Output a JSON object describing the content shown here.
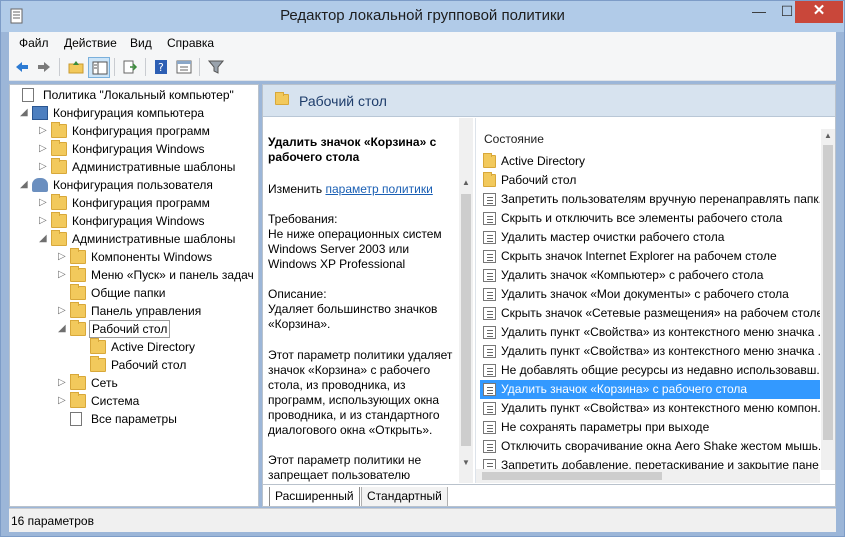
{
  "window": {
    "title": "Редактор локальной групповой политики"
  },
  "menu": {
    "items": [
      "Файл",
      "Действие",
      "Вид",
      "Справка"
    ]
  },
  "tree": {
    "items": [
      {
        "label": "Политика \"Локальный компьютер\"",
        "level": 0,
        "arrow": "",
        "icon": "policy-icon"
      },
      {
        "label": "Конфигурация компьютера",
        "level": 1,
        "arrow": "◢",
        "icon": "computer-icon"
      },
      {
        "label": "Конфигурация программ",
        "level": 2,
        "arrow": "▷",
        "icon": "folder-icon"
      },
      {
        "label": "Конфигурация Windows",
        "level": 2,
        "arrow": "▷",
        "icon": "folder-icon"
      },
      {
        "label": "Административные шаблоны",
        "level": 2,
        "arrow": "▷",
        "icon": "folder-icon"
      },
      {
        "label": "Конфигурация пользователя",
        "level": 1,
        "arrow": "◢",
        "icon": "user-icon"
      },
      {
        "label": "Конфигурация программ",
        "level": 2,
        "arrow": "▷",
        "icon": "folder-icon"
      },
      {
        "label": "Конфигурация Windows",
        "level": 2,
        "arrow": "▷",
        "icon": "folder-icon"
      },
      {
        "label": "Административные шаблоны",
        "level": 2,
        "arrow": "◢",
        "icon": "folder-icon"
      },
      {
        "label": "Компоненты Windows",
        "level": 3,
        "arrow": "▷",
        "icon": "folder-icon"
      },
      {
        "label": "Меню «Пуск» и панель задач",
        "level": 3,
        "arrow": "▷",
        "icon": "folder-icon"
      },
      {
        "label": "Общие папки",
        "level": 3,
        "arrow": "",
        "icon": "folder-icon"
      },
      {
        "label": "Панель управления",
        "level": 3,
        "arrow": "▷",
        "icon": "folder-icon"
      },
      {
        "label": "Рабочий стол",
        "level": 3,
        "arrow": "◢",
        "icon": "folder-icon",
        "selected": true
      },
      {
        "label": "Active Directory",
        "level": 4,
        "arrow": "",
        "icon": "folder-icon"
      },
      {
        "label": "Рабочий стол",
        "level": 4,
        "arrow": "",
        "icon": "folder-icon"
      },
      {
        "label": "Сеть",
        "level": 3,
        "arrow": "▷",
        "icon": "folder-icon"
      },
      {
        "label": "Система",
        "level": 3,
        "arrow": "▷",
        "icon": "folder-icon"
      },
      {
        "label": "Все параметры",
        "level": 3,
        "arrow": "",
        "icon": "settings-icon"
      }
    ]
  },
  "right": {
    "header_title": "Рабочий стол",
    "description": {
      "title": "Удалить значок «Корзина» с рабочего стола",
      "edit_prefix": "Изменить ",
      "edit_link": "параметр политики",
      "requirements": "Требования:\nНе ниже операционных систем Windows Server 2003 или Windows XP Professional",
      "desc_label": "Описание:\nУдаляет большинство значков «Корзина».",
      "body1": "Этот параметр политики удаляет значок «Корзина» с рабочего стола, из проводника, из программ, использующих окна проводника, и из стандартного диалогового окна «Открыть».",
      "body2": "Этот параметр политики не запрещает пользователю"
    },
    "list": {
      "header": "Состояние",
      "rows": [
        {
          "label": "Active Directory",
          "type": "folder"
        },
        {
          "label": "Рабочий стол",
          "type": "folder"
        },
        {
          "label": "Запретить пользователям вручную перенаправлять папк...",
          "type": "policy"
        },
        {
          "label": "Скрыть и отключить все элементы рабочего стола",
          "type": "policy"
        },
        {
          "label": "Удалить мастер очистки рабочего стола",
          "type": "policy"
        },
        {
          "label": "Скрыть значок Internet Explorer на рабочем столе",
          "type": "policy"
        },
        {
          "label": "Удалить значок «Компьютер» с рабочего стола",
          "type": "policy"
        },
        {
          "label": "Удалить значок «Мои документы» с рабочего стола",
          "type": "policy"
        },
        {
          "label": "Скрыть значок «Сетевые размещения» на рабочем столе",
          "type": "policy"
        },
        {
          "label": "Удалить пункт «Свойства» из контекстного меню значка ...",
          "type": "policy"
        },
        {
          "label": "Удалить пункт «Свойства» из контекстного меню значка ...",
          "type": "policy"
        },
        {
          "label": "Не добавлять общие ресурсы из недавно использовавш...",
          "type": "policy"
        },
        {
          "label": "Удалить значок «Корзина» с рабочего стола",
          "type": "policy",
          "selected": true
        },
        {
          "label": "Удалить пункт «Свойства» из контекстного меню компон...",
          "type": "policy"
        },
        {
          "label": "Не сохранять параметры при выходе",
          "type": "policy"
        },
        {
          "label": "Отключить сворачивание окна Aero Shake жестом мышь...",
          "type": "policy"
        },
        {
          "label": "Запретить добавление, перетаскивание и закрытие пане...",
          "type": "policy"
        }
      ]
    },
    "tabs": {
      "extended": "Расширенный",
      "standard": "Стандартный"
    }
  },
  "status": {
    "text": "16 параметров"
  }
}
